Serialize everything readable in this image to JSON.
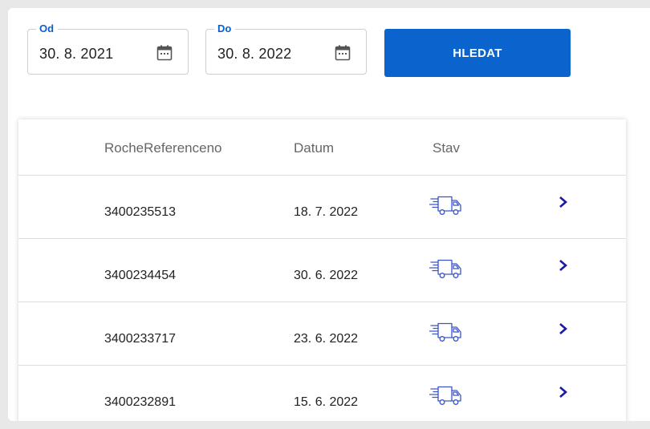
{
  "filters": {
    "from": {
      "label": "Od",
      "value": "30. 8. 2021"
    },
    "to": {
      "label": "Do",
      "value": "30. 8. 2022"
    },
    "search_label": "HLEDAT"
  },
  "table": {
    "columns": [
      "RocheReferenceno",
      "Datum",
      "Stav"
    ],
    "rows": [
      {
        "ref": "3400235513",
        "date": "18. 7. 2022",
        "status_icon": "delivery-truck-icon"
      },
      {
        "ref": "3400234454",
        "date": "30. 6. 2022",
        "status_icon": "delivery-truck-icon"
      },
      {
        "ref": "3400233717",
        "date": "23. 6. 2022",
        "status_icon": "delivery-truck-icon"
      },
      {
        "ref": "3400232891",
        "date": "15. 6. 2022",
        "status_icon": "delivery-truck-icon"
      }
    ]
  },
  "colors": {
    "accent": "#0b63ce",
    "icon_blue": "#3b55c9",
    "chevron": "#1a1aa8"
  }
}
